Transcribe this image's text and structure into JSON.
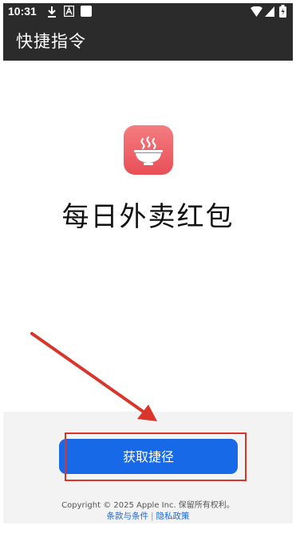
{
  "status_bar": {
    "time": "10:31",
    "icons": [
      "download-icon",
      "text-a-icon",
      "square-icon",
      "wifi-icon",
      "signal-icon",
      "battery-icon"
    ]
  },
  "app_bar": {
    "title": "快捷指令"
  },
  "shortcut": {
    "icon": "bowl-icon",
    "name": "每日外卖红包",
    "icon_color": "#ea5159"
  },
  "actions": {
    "get_shortcut_label": "获取捷径",
    "button_color": "#1769e8"
  },
  "footer": {
    "copyright": "Copyright © 2025 Apple Inc. 保留所有权利。",
    "terms_link": "条款与条件",
    "separator": "|",
    "privacy_link": "隐私政策"
  },
  "annotation": {
    "color": "#d9352b"
  }
}
